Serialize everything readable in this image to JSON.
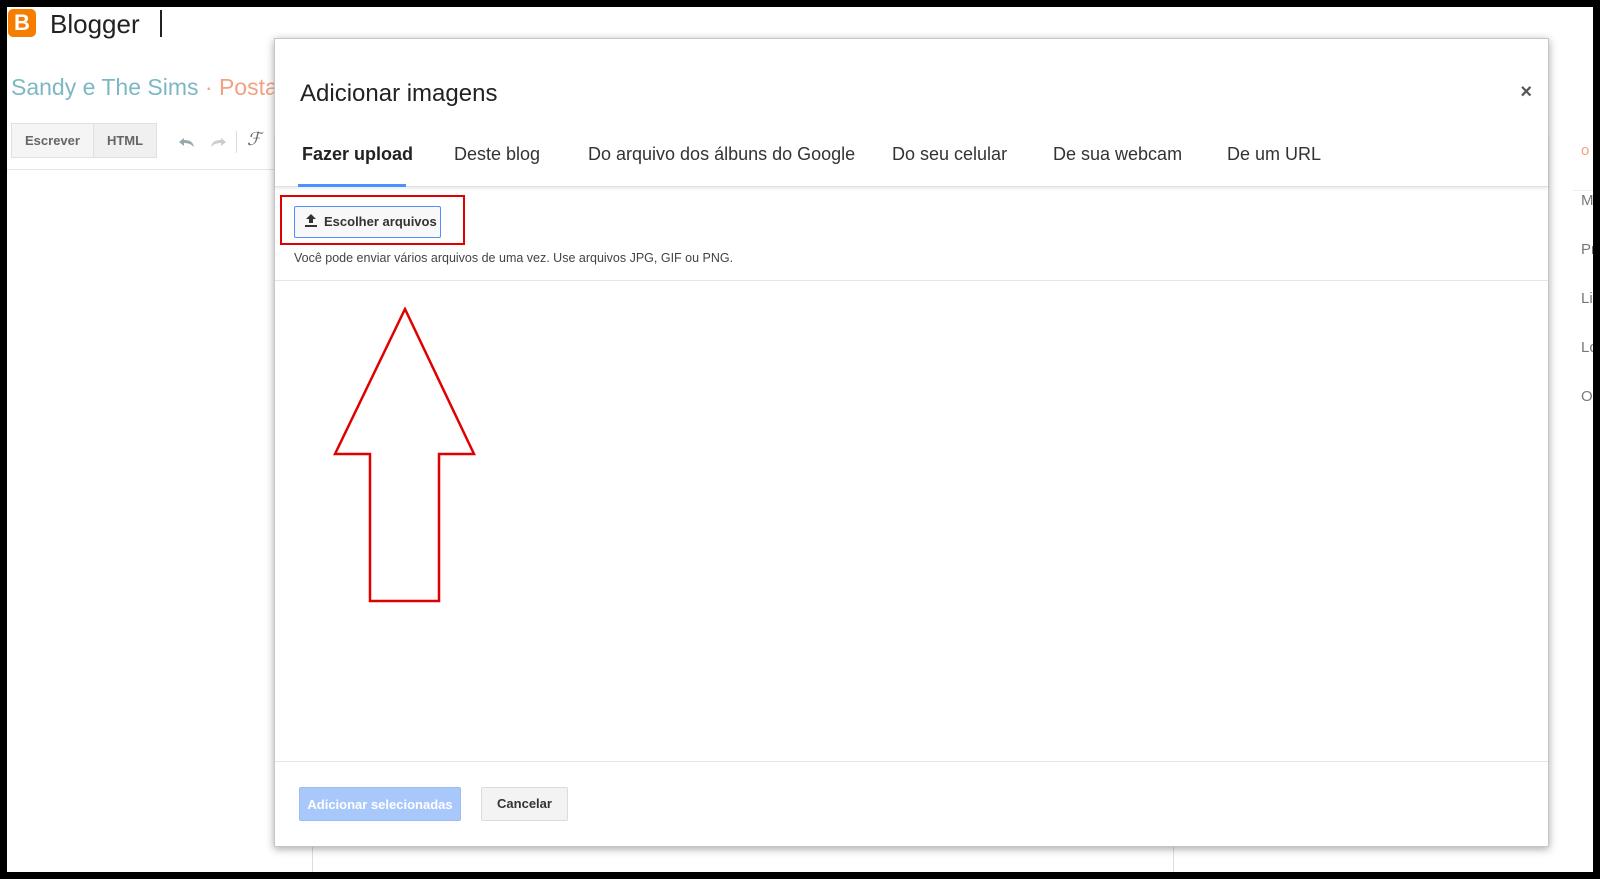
{
  "app": {
    "logo_letter": "B",
    "brand": "Blogger",
    "blog_title": "Sandy e The Sims",
    "title_separator": " · ",
    "section_title": "Postag",
    "mode_tabs": [
      "Escrever",
      "HTML"
    ],
    "format_icon": "ℱ",
    "right_panel_items": [
      "Ma",
      "Pr",
      "Li",
      "Lo",
      "Op"
    ],
    "right_edge_char": "o",
    "accent_color": "#4d90fe",
    "brand_color": "#f57d00"
  },
  "dialog": {
    "title": "Adicionar imagens",
    "close": "×",
    "tabs": [
      {
        "label": "Fazer upload",
        "active": true
      },
      {
        "label": "Deste blog",
        "active": false
      },
      {
        "label": "Do arquivo dos álbuns do Google",
        "active": false
      },
      {
        "label": "Do seu celular",
        "active": false
      },
      {
        "label": "De sua webcam",
        "active": false
      },
      {
        "label": "De um URL",
        "active": false
      }
    ],
    "upload_button": "Escolher arquivos",
    "hint": "Você pode enviar vários arquivos de uma vez. Use arquivos JPG, GIF ou PNG.",
    "primary_button": "Adicionar selecionadas",
    "cancel_button": "Cancelar"
  },
  "annotation": {
    "highlight_color": "#e00000",
    "arrow_icon": "up-arrow-annotation"
  }
}
